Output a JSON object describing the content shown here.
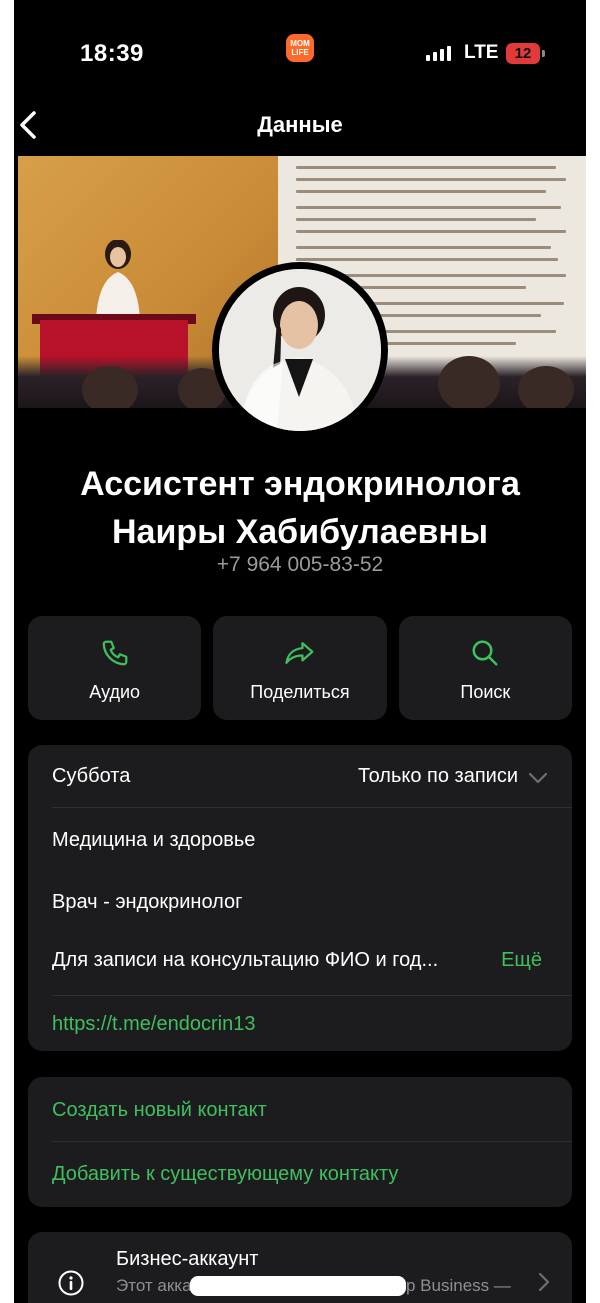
{
  "status_bar": {
    "time": "18:39",
    "app_badge": "MOM\nLIFE",
    "network": "LTE",
    "battery": "12"
  },
  "nav": {
    "title": "Данные",
    "back_icon": "chevron-left-icon"
  },
  "profile": {
    "name_line1": "Ассистент эндокринолога",
    "name_line2": "Наиры Хабибулаевны",
    "phone": "+7 964 005-83-52"
  },
  "actions": [
    {
      "label": "Аудио",
      "icon": "phone-icon"
    },
    {
      "label": "Поделиться",
      "icon": "share-icon"
    },
    {
      "label": "Поиск",
      "icon": "search-icon"
    }
  ],
  "info": {
    "day": "Суббота",
    "hours": "Только по записи",
    "category": "Медицина и здоровье",
    "role": "Врач - эндокринолог",
    "description": "Для записи на консультацию ФИО и год...",
    "more": "Ещё",
    "link": "https://t.me/endocrin13"
  },
  "contact_actions": {
    "create": "Создать новый контакт",
    "add_existing": "Добавить к существующему контакту"
  },
  "business": {
    "title": "Бизнес-аккаунт",
    "subtitle_start": "Этот акка",
    "subtitle_end": "р Business —"
  },
  "colors": {
    "accent_green": "#3fbf5e",
    "card_bg": "#1c1c1e",
    "battery_red": "#e03a3a"
  }
}
